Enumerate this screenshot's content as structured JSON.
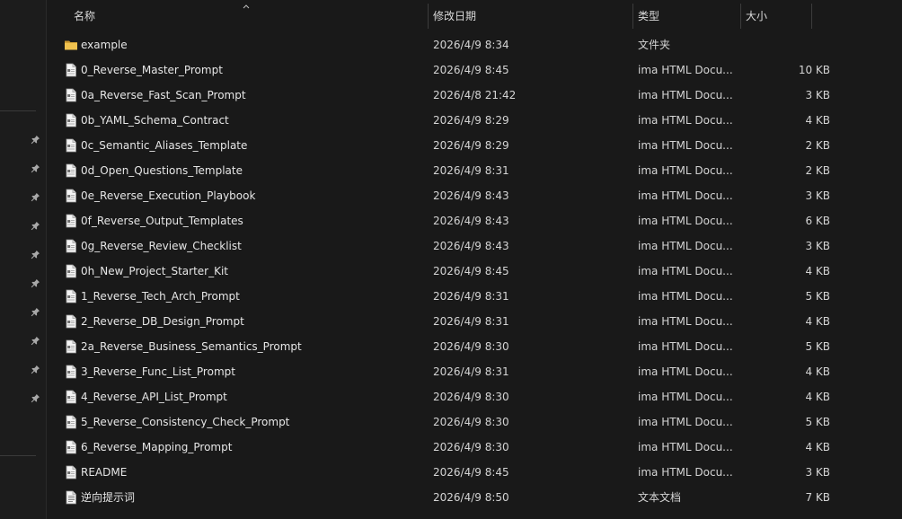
{
  "columns": {
    "name": "名称",
    "modified": "修改日期",
    "type": "类型",
    "size": "大小"
  },
  "files": [
    {
      "name": "example",
      "modified": "2026/4/9 8:34",
      "type": "文件夹",
      "size": "",
      "icon": "folder-icon"
    },
    {
      "name": "0_Reverse_Master_Prompt",
      "modified": "2026/4/9 8:45",
      "type": "ima HTML Docu...",
      "size": "10 KB",
      "icon": "document-icon"
    },
    {
      "name": "0a_Reverse_Fast_Scan_Prompt",
      "modified": "2026/4/8 21:42",
      "type": "ima HTML Docu...",
      "size": "3 KB",
      "icon": "document-icon"
    },
    {
      "name": "0b_YAML_Schema_Contract",
      "modified": "2026/4/9 8:29",
      "type": "ima HTML Docu...",
      "size": "4 KB",
      "icon": "document-icon"
    },
    {
      "name": "0c_Semantic_Aliases_Template",
      "modified": "2026/4/9 8:29",
      "type": "ima HTML Docu...",
      "size": "2 KB",
      "icon": "document-icon"
    },
    {
      "name": "0d_Open_Questions_Template",
      "modified": "2026/4/9 8:31",
      "type": "ima HTML Docu...",
      "size": "2 KB",
      "icon": "document-icon"
    },
    {
      "name": "0e_Reverse_Execution_Playbook",
      "modified": "2026/4/9 8:43",
      "type": "ima HTML Docu...",
      "size": "3 KB",
      "icon": "document-icon"
    },
    {
      "name": "0f_Reverse_Output_Templates",
      "modified": "2026/4/9 8:43",
      "type": "ima HTML Docu...",
      "size": "6 KB",
      "icon": "document-icon"
    },
    {
      "name": "0g_Reverse_Review_Checklist",
      "modified": "2026/4/9 8:43",
      "type": "ima HTML Docu...",
      "size": "3 KB",
      "icon": "document-icon"
    },
    {
      "name": "0h_New_Project_Starter_Kit",
      "modified": "2026/4/9 8:45",
      "type": "ima HTML Docu...",
      "size": "4 KB",
      "icon": "document-icon"
    },
    {
      "name": "1_Reverse_Tech_Arch_Prompt",
      "modified": "2026/4/9 8:31",
      "type": "ima HTML Docu...",
      "size": "5 KB",
      "icon": "document-icon"
    },
    {
      "name": "2_Reverse_DB_Design_Prompt",
      "modified": "2026/4/9 8:31",
      "type": "ima HTML Docu...",
      "size": "4 KB",
      "icon": "document-icon"
    },
    {
      "name": "2a_Reverse_Business_Semantics_Prompt",
      "modified": "2026/4/9 8:30",
      "type": "ima HTML Docu...",
      "size": "5 KB",
      "icon": "document-icon"
    },
    {
      "name": "3_Reverse_Func_List_Prompt",
      "modified": "2026/4/9 8:31",
      "type": "ima HTML Docu...",
      "size": "4 KB",
      "icon": "document-icon"
    },
    {
      "name": "4_Reverse_API_List_Prompt",
      "modified": "2026/4/9 8:30",
      "type": "ima HTML Docu...",
      "size": "4 KB",
      "icon": "document-icon"
    },
    {
      "name": "5_Reverse_Consistency_Check_Prompt",
      "modified": "2026/4/9 8:30",
      "type": "ima HTML Docu...",
      "size": "5 KB",
      "icon": "document-icon"
    },
    {
      "name": "6_Reverse_Mapping_Prompt",
      "modified": "2026/4/9 8:30",
      "type": "ima HTML Docu...",
      "size": "4 KB",
      "icon": "document-icon"
    },
    {
      "name": "README",
      "modified": "2026/4/9 8:45",
      "type": "ima HTML Docu...",
      "size": "3 KB",
      "icon": "document-icon"
    },
    {
      "name": "逆向提示词",
      "modified": "2026/4/9 8:50",
      "type": "文本文档",
      "size": "7 KB",
      "icon": "text-file-icon"
    }
  ],
  "sidebar": {
    "pin_count": 10,
    "pin_icon": "pin-icon"
  },
  "colors": {
    "background": "#191919",
    "folder": "#e8b84a",
    "text": "#e6e6e6"
  }
}
